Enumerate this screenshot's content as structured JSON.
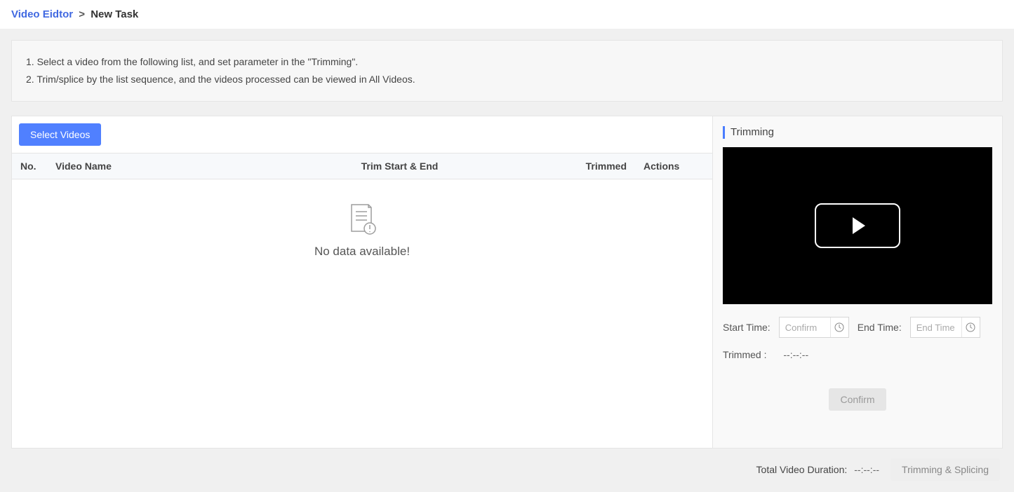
{
  "breadcrumb": {
    "link": "Video Eidtor",
    "sep": ">",
    "current": "New Task"
  },
  "info": {
    "line1": "1. Select a video from the following list, and set parameter in the \"Trimming\".",
    "line2": "2. Trim/splice by the list sequence, and the videos processed can be viewed in All Videos."
  },
  "left": {
    "select_btn": "Select Videos",
    "cols": {
      "no": "No.",
      "name": "Video Name",
      "trim": "Trim Start & End",
      "trimmed": "Trimmed",
      "actions": "Actions"
    },
    "empty": "No data available!"
  },
  "right": {
    "title": "Trimming",
    "start_label": "Start Time:",
    "start_placeholder": "Confirm",
    "end_label": "End Time:",
    "end_placeholder": "End Time",
    "trimmed_label": "Trimmed :",
    "trimmed_value": "--:--:--",
    "confirm_btn": "Confirm"
  },
  "footer": {
    "duration_label": "Total Video Duration:",
    "duration_value": "--:--:--",
    "submit_btn": "Trimming & Splicing"
  }
}
